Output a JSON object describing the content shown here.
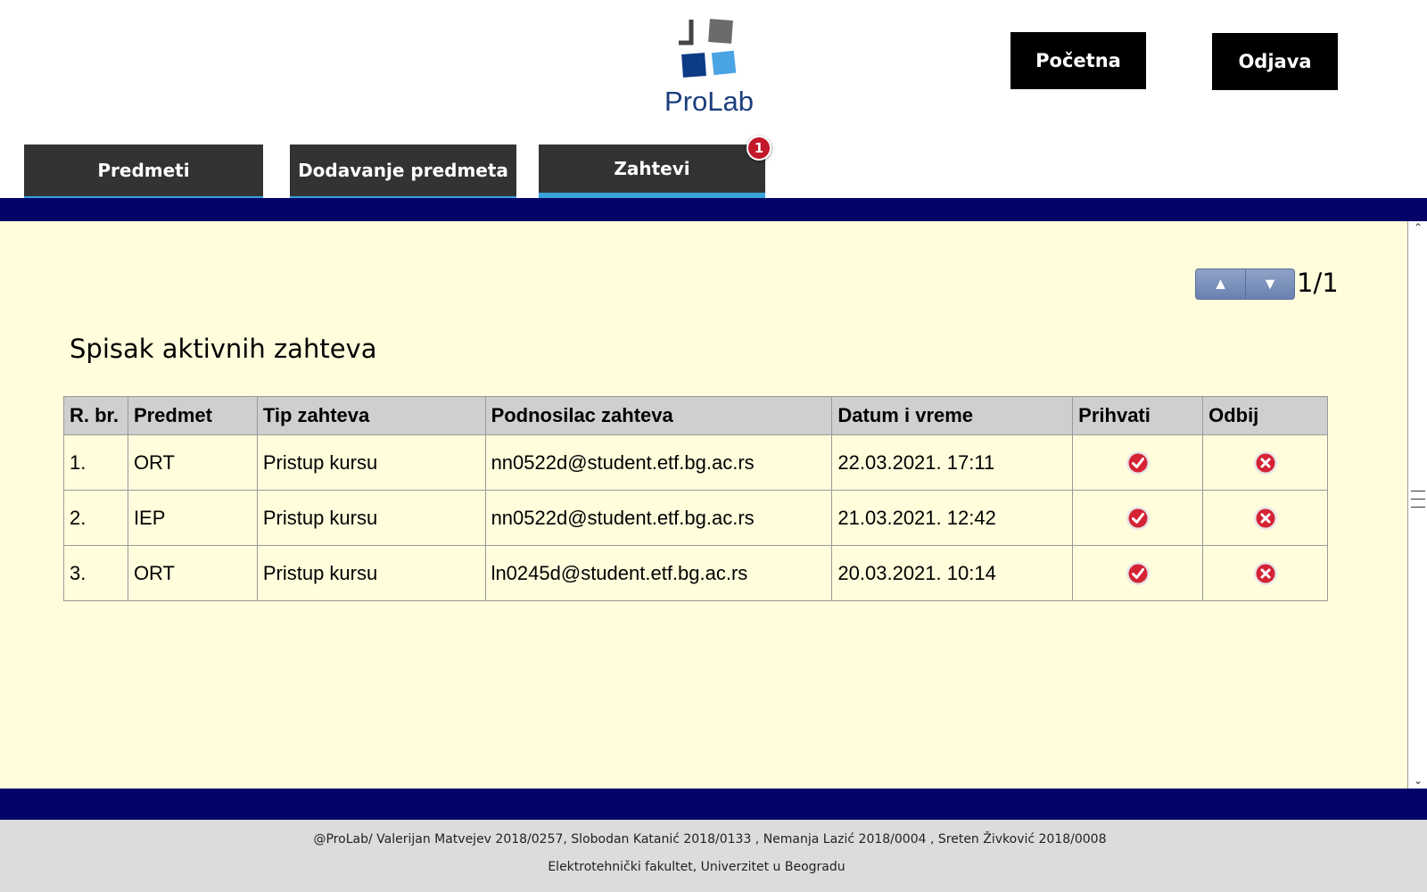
{
  "header": {
    "logo_text": "ProLab",
    "home_label": "Početna",
    "logout_label": "Odjava"
  },
  "tabs": [
    {
      "label": "Predmeti"
    },
    {
      "label": "Dodavanje predmeta"
    },
    {
      "label": "Zahtevi",
      "badge": "1"
    }
  ],
  "pager": {
    "text": "1/1",
    "up_icon": "triangle-up-icon",
    "down_icon": "triangle-down-icon"
  },
  "list_title": "Spisak aktivnih zahteva",
  "table": {
    "headers": [
      "R. br.",
      "Predmet",
      "Tip zahteva",
      "Podnosilac zahteva",
      "Datum i vreme",
      "Prihvati",
      "Odbij"
    ],
    "rows": [
      {
        "no": "1.",
        "subject": "ORT",
        "type": "Pristup kursu",
        "requester": "nn0522d@student.etf.bg.ac.rs",
        "datetime": "22.03.2021. 17:11"
      },
      {
        "no": "2.",
        "subject": "IEP",
        "type": "Pristup kursu",
        "requester": "nn0522d@student.etf.bg.ac.rs",
        "datetime": "21.03.2021. 12:42"
      },
      {
        "no": "3.",
        "subject": "ORT",
        "type": "Pristup kursu",
        "requester": "ln0245d@student.etf.bg.ac.rs",
        "datetime": "20.03.2021. 10:14"
      }
    ],
    "accept_icon": "check-circle-icon",
    "reject_icon": "x-circle-icon"
  },
  "footer": {
    "line1": "@ProLab/ Valerijan Matvejev 2018/0257, Slobodan Katanić 2018/0133 , Nemanja Lazić 2018/0004 , Sreten Živković 2018/0008",
    "line2": "Elektrotehnički fakultet, Univerzitet u Beogradu"
  },
  "colors": {
    "navy": "#030368",
    "content_bg": "#fffddc",
    "tab_bg": "#333333",
    "tab_accent": "#3aa3db",
    "badge": "#c3182a",
    "accept": "#d42335",
    "reject": "#d42335"
  }
}
